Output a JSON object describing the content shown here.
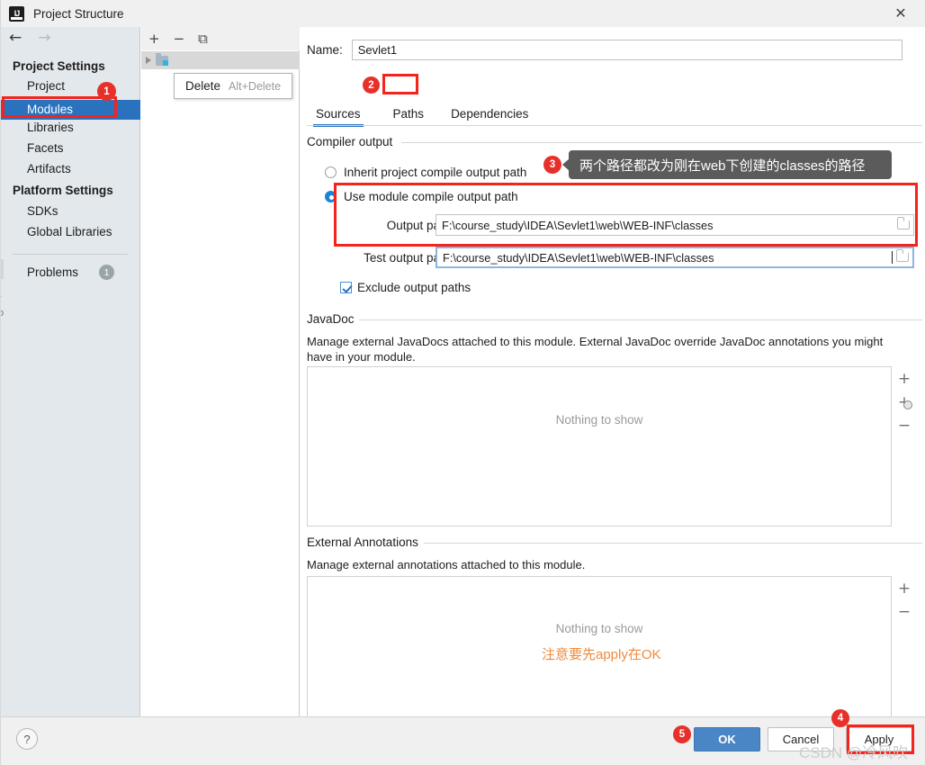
{
  "window": {
    "title": "Project Structure",
    "app_icon": "intellij-idea-icon",
    "close_label": "✕"
  },
  "sidebar": {
    "back_label": "←",
    "forward_label": "→",
    "sections": [
      {
        "heading": "Project Settings",
        "items": [
          {
            "label": "Project",
            "selected": false
          },
          {
            "label": "Modules",
            "selected": true
          },
          {
            "label": "Libraries",
            "selected": false
          },
          {
            "label": "Facets",
            "selected": false
          },
          {
            "label": "Artifacts",
            "selected": false
          }
        ]
      },
      {
        "heading": "Platform Settings",
        "items": [
          {
            "label": "SDKs",
            "selected": false
          },
          {
            "label": "Global Libraries",
            "selected": false
          }
        ]
      }
    ],
    "problems": {
      "label": "Problems",
      "count": "1"
    }
  },
  "tree_panel": {
    "toolbar": {
      "add_label": "+",
      "remove_label": "−",
      "copy_label": "⧉"
    },
    "context_menu": {
      "item_label": "Delete",
      "item_shortcut": "Alt+Delete"
    }
  },
  "module": {
    "name_label": "Name:",
    "name_value": "Sevlet1",
    "tabs": [
      {
        "label": "Sources",
        "active": true
      },
      {
        "label": "Paths",
        "active": false
      },
      {
        "label": "Dependencies",
        "active": false
      }
    ],
    "compiler_output": {
      "group_title": "Compiler output",
      "radio_inherit": "Inherit project compile output path",
      "radio_module": "Use module compile output path",
      "selected_radio": "module",
      "output_path_label": "Output path:",
      "output_path_value": "F:\\course_study\\IDEA\\Sevlet1\\web\\WEB-INF\\classes",
      "test_output_path_label": "Test output path:",
      "test_output_path_value": "F:\\course_study\\IDEA\\Sevlet1\\web\\WEB-INF\\classes",
      "exclude_label": "Exclude output paths",
      "exclude_checked": true,
      "browse_icon": "folder-browse-icon"
    },
    "javadoc": {
      "group_title": "JavaDoc",
      "description": "Manage external JavaDocs attached to this module. External JavaDoc override JavaDoc annotations you might have in your module.",
      "empty_text": "Nothing to show",
      "buttons": {
        "add": "+",
        "add_library": "+",
        "remove": "−"
      }
    },
    "external_annotations": {
      "group_title": "External Annotations",
      "description": "Manage external annotations attached to this module.",
      "empty_text": "Nothing to show",
      "buttons": {
        "add": "+",
        "remove": "−"
      }
    }
  },
  "footer": {
    "help_label": "?",
    "ok_label": "OK",
    "cancel_label": "Cancel",
    "apply_label": "Apply"
  },
  "annotations": {
    "badges": [
      {
        "num": "1"
      },
      {
        "num": "2"
      },
      {
        "num": "3"
      },
      {
        "num": "4"
      },
      {
        "num": "5"
      }
    ],
    "callout_text": "两个路径都改为刚在web下创建的classes的路径",
    "orange_note": "注意要先apply在OK",
    "watermark": "CSDN @冷风吹"
  },
  "colors": {
    "accent": "#2a72bd",
    "annotation_red": "#f4231c",
    "badge_red": "#e8302a",
    "orange": "#f08a3c",
    "primary_button": "#4a86c5"
  }
}
